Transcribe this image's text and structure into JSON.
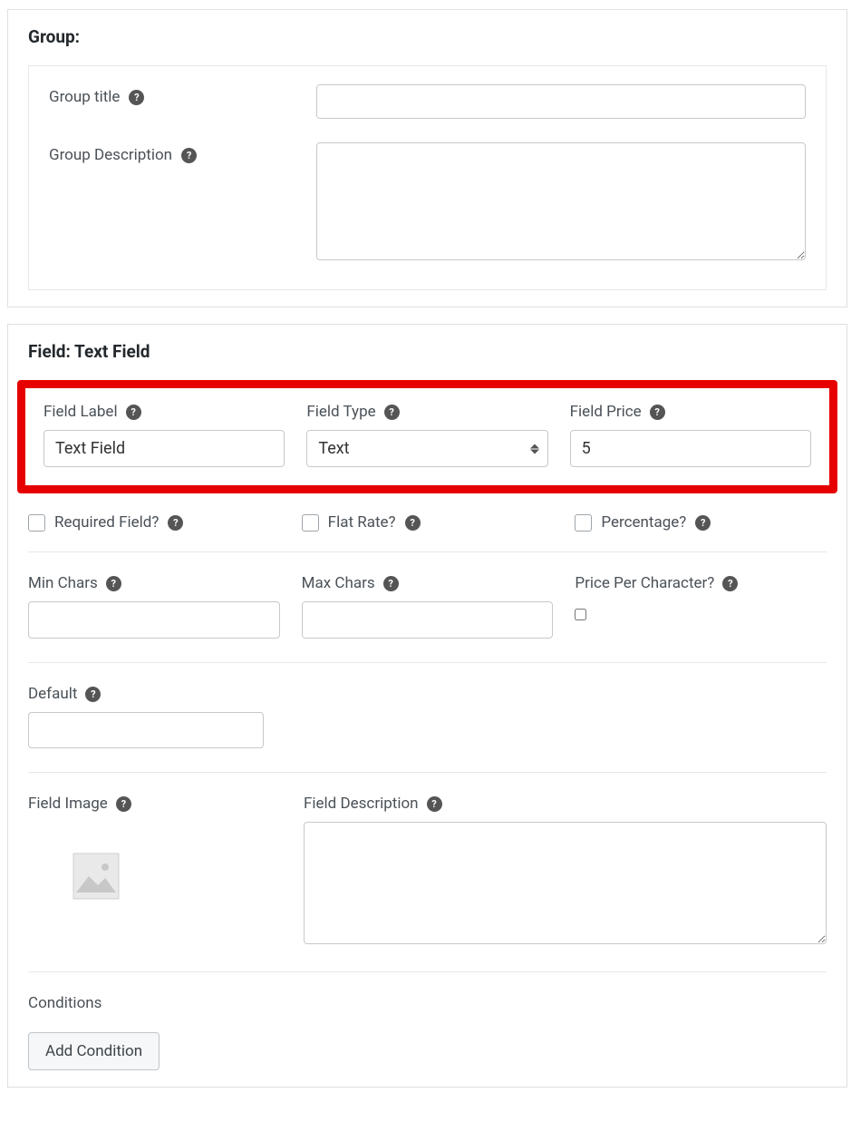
{
  "group": {
    "heading": "Group:",
    "title_label": "Group title",
    "title_value": "",
    "desc_label": "Group Description",
    "desc_value": ""
  },
  "field": {
    "heading": "Field: Text Field",
    "label_label": "Field Label",
    "label_value": "Text Field",
    "type_label": "Field Type",
    "type_value": "Text",
    "price_label": "Field Price",
    "price_value": "5",
    "required_label": "Required Field?",
    "required_checked": false,
    "flat_label": "Flat Rate?",
    "flat_checked": false,
    "percentage_label": "Percentage?",
    "percentage_checked": false,
    "min_label": "Min Chars",
    "min_value": "",
    "max_label": "Max Chars",
    "max_value": "",
    "ppc_label": "Price Per Character?",
    "ppc_checked": false,
    "default_label": "Default",
    "default_value": "",
    "image_label": "Field Image",
    "desc_label": "Field Description",
    "desc_value": "",
    "conditions_label": "Conditions",
    "add_condition_label": "Add Condition"
  }
}
